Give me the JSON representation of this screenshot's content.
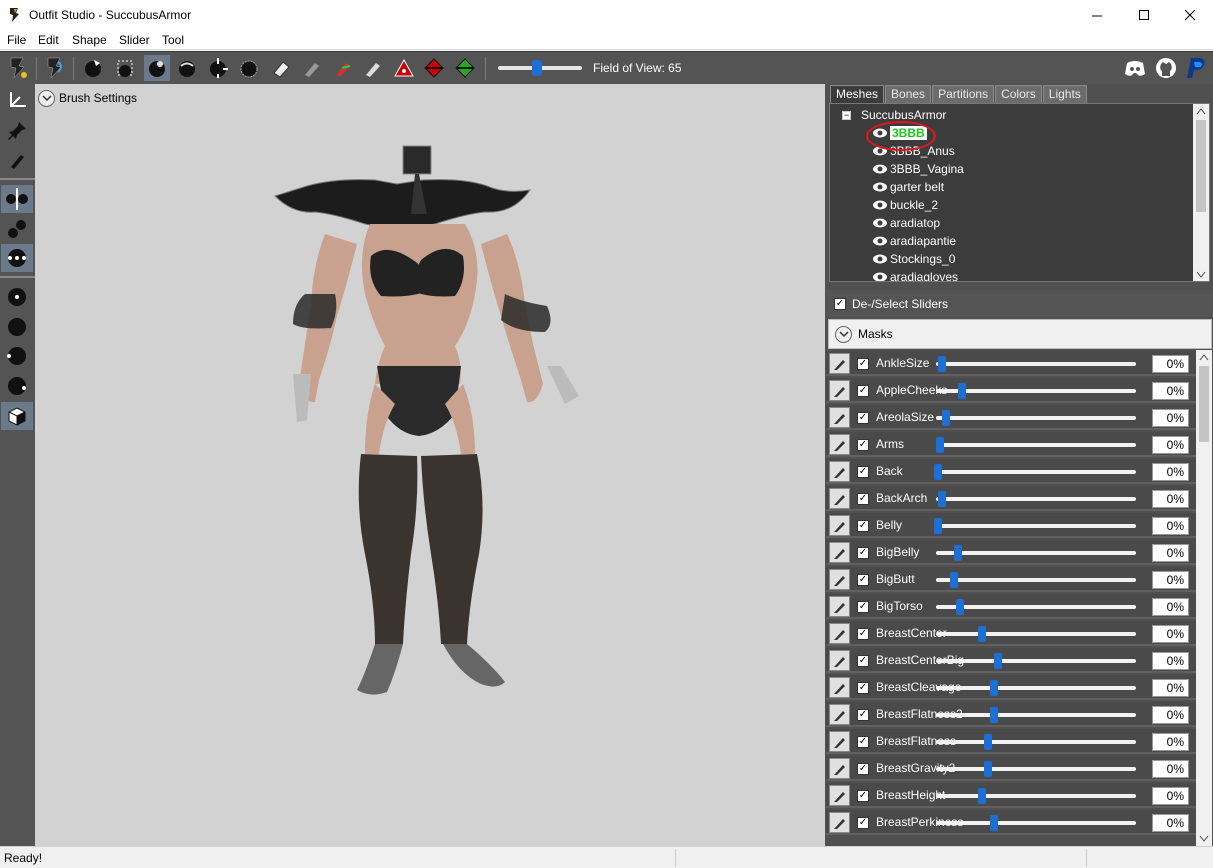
{
  "window": {
    "title": "Outfit Studio - SuccubusArmor",
    "minimize": "—",
    "maximize": "☐",
    "close": "✕"
  },
  "menu": [
    "File",
    "Edit",
    "Shape",
    "Slider",
    "Tool"
  ],
  "toolbar": {
    "fov_label": "Field of View: 65",
    "fov_value": 65
  },
  "brush_settings": {
    "label": "Brush Settings"
  },
  "tabs": [
    "Meshes",
    "Bones",
    "Partitions",
    "Colors",
    "Lights"
  ],
  "active_tab": "Meshes",
  "tree": {
    "root": "SuccubusArmor",
    "items": [
      "3BBB",
      "3BBB_Anus",
      "3BBB_Vagina",
      "garter belt",
      "buckle_2",
      "aradiatop",
      "aradiapantie",
      "Stockings_0",
      "aradiagloves"
    ],
    "selected": "3BBB"
  },
  "deselect_label": "De-/Select Sliders",
  "masks_label": "Masks",
  "sliders": [
    {
      "name": "AnkleSize",
      "value": "0%",
      "pos": 0.03
    },
    {
      "name": "AppleCheeks",
      "value": "0%",
      "pos": 0.13
    },
    {
      "name": "AreolaSize",
      "value": "0%",
      "pos": 0.05
    },
    {
      "name": "Arms",
      "value": "0%",
      "pos": 0.02
    },
    {
      "name": "Back",
      "value": "0%",
      "pos": 0.01
    },
    {
      "name": "BackArch",
      "value": "0%",
      "pos": 0.03
    },
    {
      "name": "Belly",
      "value": "0%",
      "pos": 0.01
    },
    {
      "name": "BigBelly",
      "value": "0%",
      "pos": 0.11
    },
    {
      "name": "BigButt",
      "value": "0%",
      "pos": 0.09
    },
    {
      "name": "BigTorso",
      "value": "0%",
      "pos": 0.12
    },
    {
      "name": "BreastCenter",
      "value": "0%",
      "pos": 0.23
    },
    {
      "name": "BreastCenterBig",
      "value": "0%",
      "pos": 0.31
    },
    {
      "name": "BreastCleavage",
      "value": "0%",
      "pos": 0.29
    },
    {
      "name": "BreastFlatness2",
      "value": "0%",
      "pos": 0.29
    },
    {
      "name": "BreastFlatness",
      "value": "0%",
      "pos": 0.26
    },
    {
      "name": "BreastGravity2",
      "value": "0%",
      "pos": 0.26
    },
    {
      "name": "BreastHeight",
      "value": "0%",
      "pos": 0.23
    },
    {
      "name": "BreastPerkiness",
      "value": "0%",
      "pos": 0.29
    }
  ],
  "status": "Ready!"
}
